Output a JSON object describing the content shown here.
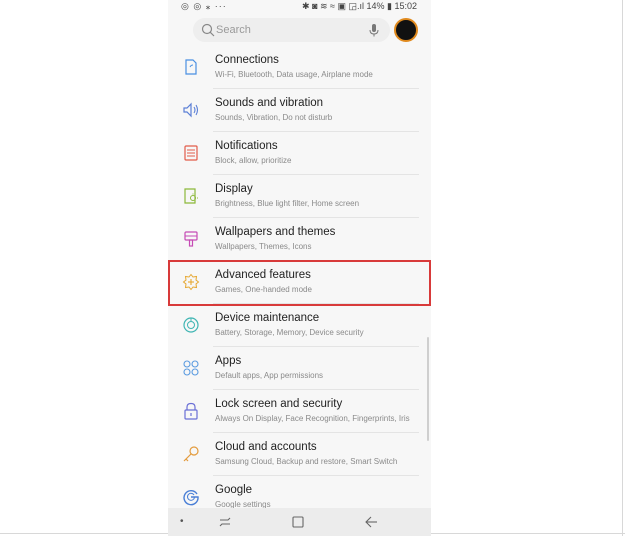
{
  "status_bar": {
    "left_icons": "◎ ◎ ⁎ ···",
    "right_text": "✱ ◙ ≋ ≈ ▣ ◲.ıl 14% ▮ 15:02",
    "battery": "14%",
    "time": "15:02"
  },
  "search": {
    "placeholder": "Search"
  },
  "settings": [
    {
      "title": "Connections",
      "subtitle": "Wi-Fi, Bluetooth, Data usage, Airplane mode",
      "icon": "connections-icon",
      "color": "#4a90e2"
    },
    {
      "title": "Sounds and vibration",
      "subtitle": "Sounds, Vibration, Do not disturb",
      "icon": "sound-icon",
      "color": "#5b7fd6"
    },
    {
      "title": "Notifications",
      "subtitle": "Block, allow, prioritize",
      "icon": "notifications-icon",
      "color": "#e25b4a"
    },
    {
      "title": "Display",
      "subtitle": "Brightness, Blue light filter, Home screen",
      "icon": "display-icon",
      "color": "#8cb83a"
    },
    {
      "title": "Wallpapers and themes",
      "subtitle": "Wallpapers, Themes, Icons",
      "icon": "wallpaper-icon",
      "color": "#c64bb5"
    },
    {
      "title": "Advanced features",
      "subtitle": "Games, One-handed mode",
      "icon": "advanced-features-icon",
      "color": "#e6a832"
    },
    {
      "title": "Device maintenance",
      "subtitle": "Battery, Storage, Memory, Device security",
      "icon": "device-maintenance-icon",
      "color": "#3fb5b3"
    },
    {
      "title": "Apps",
      "subtitle": "Default apps, App permissions",
      "icon": "apps-icon",
      "color": "#5b9be0"
    },
    {
      "title": "Lock screen and security",
      "subtitle": "Always On Display, Face Recognition, Fingerprints, Iris",
      "icon": "lock-icon",
      "color": "#6a6fd6"
    },
    {
      "title": "Cloud and accounts",
      "subtitle": "Samsung Cloud, Backup and restore, Smart Switch",
      "icon": "key-icon",
      "color": "#e39b3c"
    },
    {
      "title": "Google",
      "subtitle": "Google settings",
      "icon": "google-icon",
      "color": "#4a7fd6"
    }
  ],
  "highlight_color": "#d83a3a",
  "nav_bar": {
    "dot": "•",
    "recents": "recents-icon",
    "home": "home-icon",
    "back": "back-icon"
  }
}
